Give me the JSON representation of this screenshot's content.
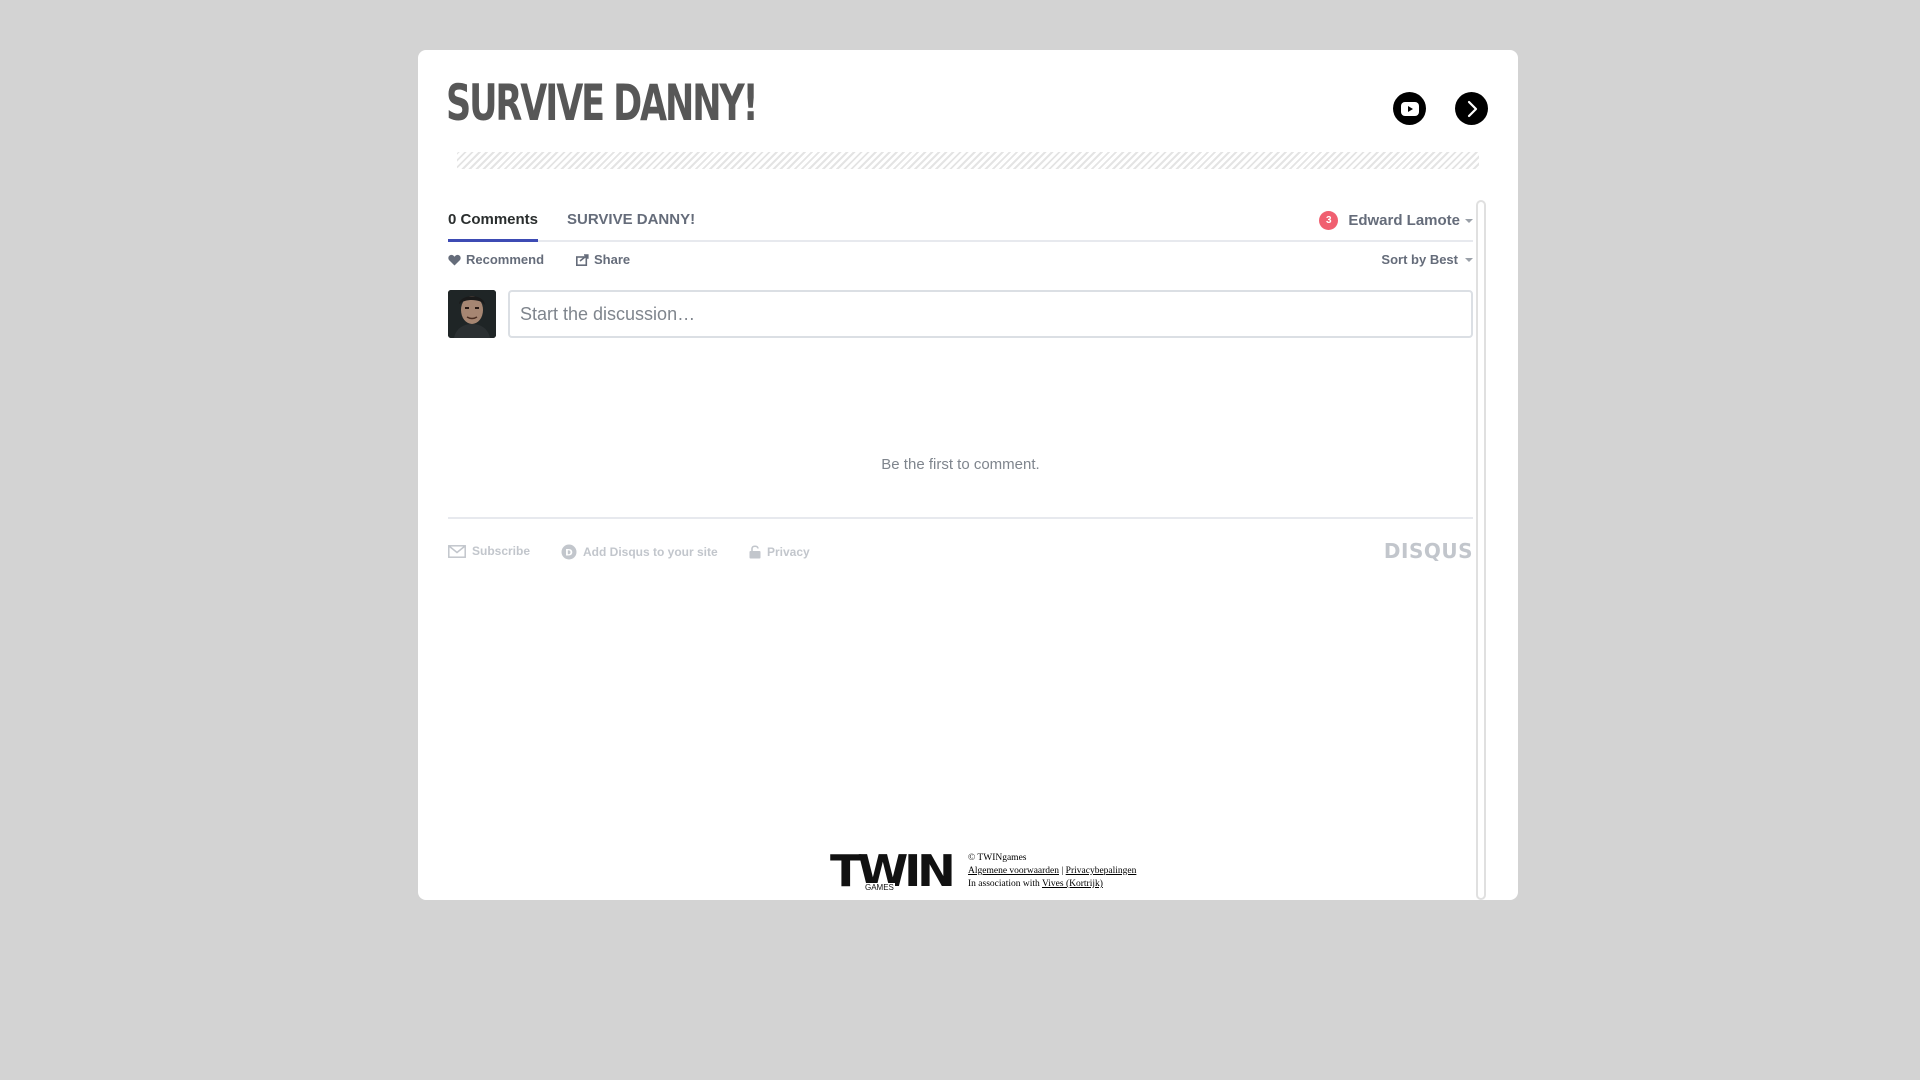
{
  "game": {
    "title": "SURVIVE DANNY!",
    "youtube_icon": "youtube-icon",
    "next_icon": "chevron-right-icon"
  },
  "disqus": {
    "tabs": [
      {
        "label": "0 Comments",
        "active": true
      },
      {
        "label": "SURVIVE DANNY!",
        "active": false
      }
    ],
    "notifications": "3",
    "user_name": "Edward Lamote",
    "recommend_label": "Recommend",
    "share_label": "Share",
    "sort_label": "Sort by Best",
    "input_placeholder": "Start the discussion…",
    "empty_message": "Be the first to comment.",
    "footer": {
      "subscribe": "Subscribe",
      "add_disqus": "Add Disqus to your site",
      "privacy": "Privacy",
      "logo": "DISQUS"
    },
    "accent_color": "#3d4bb4",
    "badge_color": "#f05f70"
  },
  "site_footer": {
    "logo_text": "TWIN",
    "logo_sub": "GAMES",
    "copyright": "© TWINgames",
    "terms": "Algemene voorwaarden",
    "separator": "|",
    "privacy": "Privacybepalingen",
    "association_prefix": "In association with",
    "association_link": "Vives (Kortrijk)"
  }
}
